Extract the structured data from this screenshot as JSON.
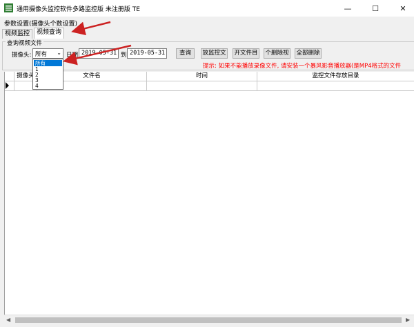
{
  "window": {
    "title": "通用摄像头监控软件多路监控版 未注册版 TE",
    "minimize": "—",
    "maximize": "☐",
    "close": "✕"
  },
  "menu": {
    "item": "参数设置(摄像头个数设置)"
  },
  "tabs": [
    {
      "label": "视频监控"
    },
    {
      "label": "视频查询"
    }
  ],
  "query": {
    "group_label": "查询视频文件",
    "camera_label": "摄像头:",
    "camera_value": "所有",
    "date_label": "日期",
    "date_from": "2019-05-31",
    "to_label": "到",
    "date_to": "2019-05-31",
    "buttons": {
      "query": "查询",
      "play": "放监控文",
      "open": "开文件目",
      "delete": "个删除视",
      "delete_all": "全部删除"
    },
    "hint": "提示: 如果不能播放录像文件, 请安装一个暴风影音播放器(是MP4格式的文件"
  },
  "dropdown": {
    "options": [
      "所有",
      "1",
      "2",
      "3",
      "4"
    ],
    "selected_index": 0
  },
  "grid": {
    "columns": [
      "摄像头",
      "文件名",
      "时间",
      "监控文件存放目录"
    ]
  },
  "colors": {
    "accent": "#0078d7",
    "hint": "#ff0000",
    "arrow": "#cc2222"
  },
  "icons": [
    "app-icon",
    "chevron-down-icon",
    "row-indicator-icon",
    "scroll-left-icon",
    "scroll-right-icon"
  ]
}
